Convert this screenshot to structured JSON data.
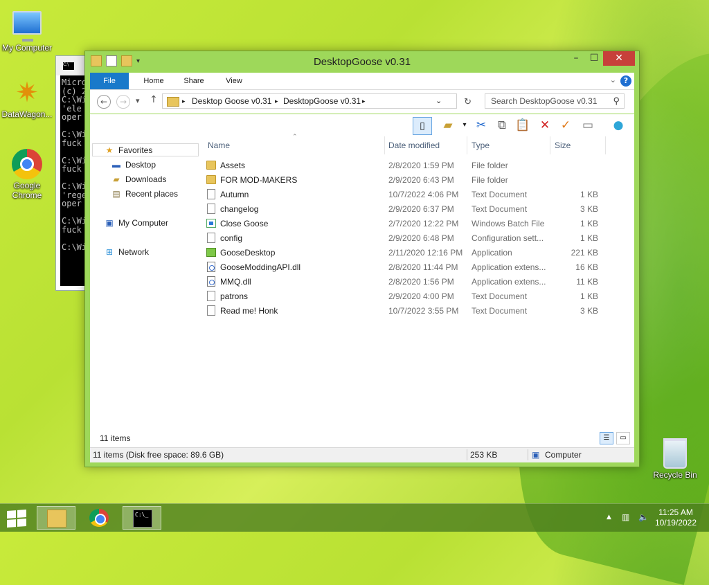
{
  "desktop": {
    "icons": [
      {
        "label": "My Computer",
        "icon": "computer-icon"
      },
      {
        "label": "DataWagon...",
        "icon": "datawagon-icon"
      },
      {
        "label": "Google Chrome",
        "icon": "chrome-icon"
      },
      {
        "label": "Recycle Bin",
        "icon": "recycle-bin-icon"
      }
    ]
  },
  "console": {
    "lines": [
      "Micro",
      "(c) 2",
      "C:\\Wi",
      "'ele",
      "oper",
      "",
      "C:\\Wi",
      "fuck",
      "",
      "C:\\Wi",
      "fuck",
      "",
      "C:\\Wi",
      "'rege",
      "oper",
      "",
      "C:\\Wi",
      "fuck",
      "",
      "C:\\Wi"
    ]
  },
  "explorer": {
    "title": "DesktopGoose v0.31",
    "ribbon_tabs": [
      "File",
      "Home",
      "Share",
      "View"
    ],
    "address": {
      "crumbs": [
        "Desktop Goose v0.31",
        "DesktopGoose v0.31"
      ]
    },
    "search_placeholder": "Search DesktopGoose v0.31",
    "nav": {
      "favorites": "Favorites",
      "desktop": "Desktop",
      "downloads": "Downloads",
      "recent": "Recent places",
      "computer": "My Computer",
      "network": "Network"
    },
    "columns": {
      "name": "Name",
      "date": "Date modified",
      "type": "Type",
      "size": "Size"
    },
    "files": [
      {
        "name": "Assets",
        "date": "2/8/2020 1:59 PM",
        "type": "File folder",
        "size": "",
        "icon": "folder"
      },
      {
        "name": "FOR MOD-MAKERS",
        "date": "2/9/2020 6:43 PM",
        "type": "File folder",
        "size": "",
        "icon": "folder"
      },
      {
        "name": "Autumn",
        "date": "10/7/2022 4:06 PM",
        "type": "Text Document",
        "size": "1 KB",
        "icon": "doc"
      },
      {
        "name": "changelog",
        "date": "2/9/2020 6:37 PM",
        "type": "Text Document",
        "size": "3 KB",
        "icon": "doc"
      },
      {
        "name": "Close Goose",
        "date": "2/7/2020 12:22 PM",
        "type": "Windows Batch File",
        "size": "1 KB",
        "icon": "bat"
      },
      {
        "name": "config",
        "date": "2/9/2020 6:48 PM",
        "type": "Configuration sett...",
        "size": "1 KB",
        "icon": "doc"
      },
      {
        "name": "GooseDesktop",
        "date": "2/11/2020 12:16 PM",
        "type": "Application",
        "size": "221 KB",
        "icon": "app"
      },
      {
        "name": "GooseModdingAPI.dll",
        "date": "2/8/2020 11:44 PM",
        "type": "Application extens...",
        "size": "16 KB",
        "icon": "dll"
      },
      {
        "name": "MMQ.dll",
        "date": "2/8/2020 1:56 PM",
        "type": "Application extens...",
        "size": "11 KB",
        "icon": "dll"
      },
      {
        "name": "patrons",
        "date": "2/9/2020 4:00 PM",
        "type": "Text Document",
        "size": "1 KB",
        "icon": "doc"
      },
      {
        "name": "Read me! Honk",
        "date": "10/7/2022 3:55 PM",
        "type": "Text Document",
        "size": "3 KB",
        "icon": "doc"
      }
    ],
    "item_count": "11 items",
    "status": {
      "left": "11 items (Disk free space: 89.6 GB)",
      "size": "253 KB",
      "location": "Computer"
    }
  },
  "taskbar": {
    "time": "11:25 AM",
    "date": "10/19/2022"
  }
}
